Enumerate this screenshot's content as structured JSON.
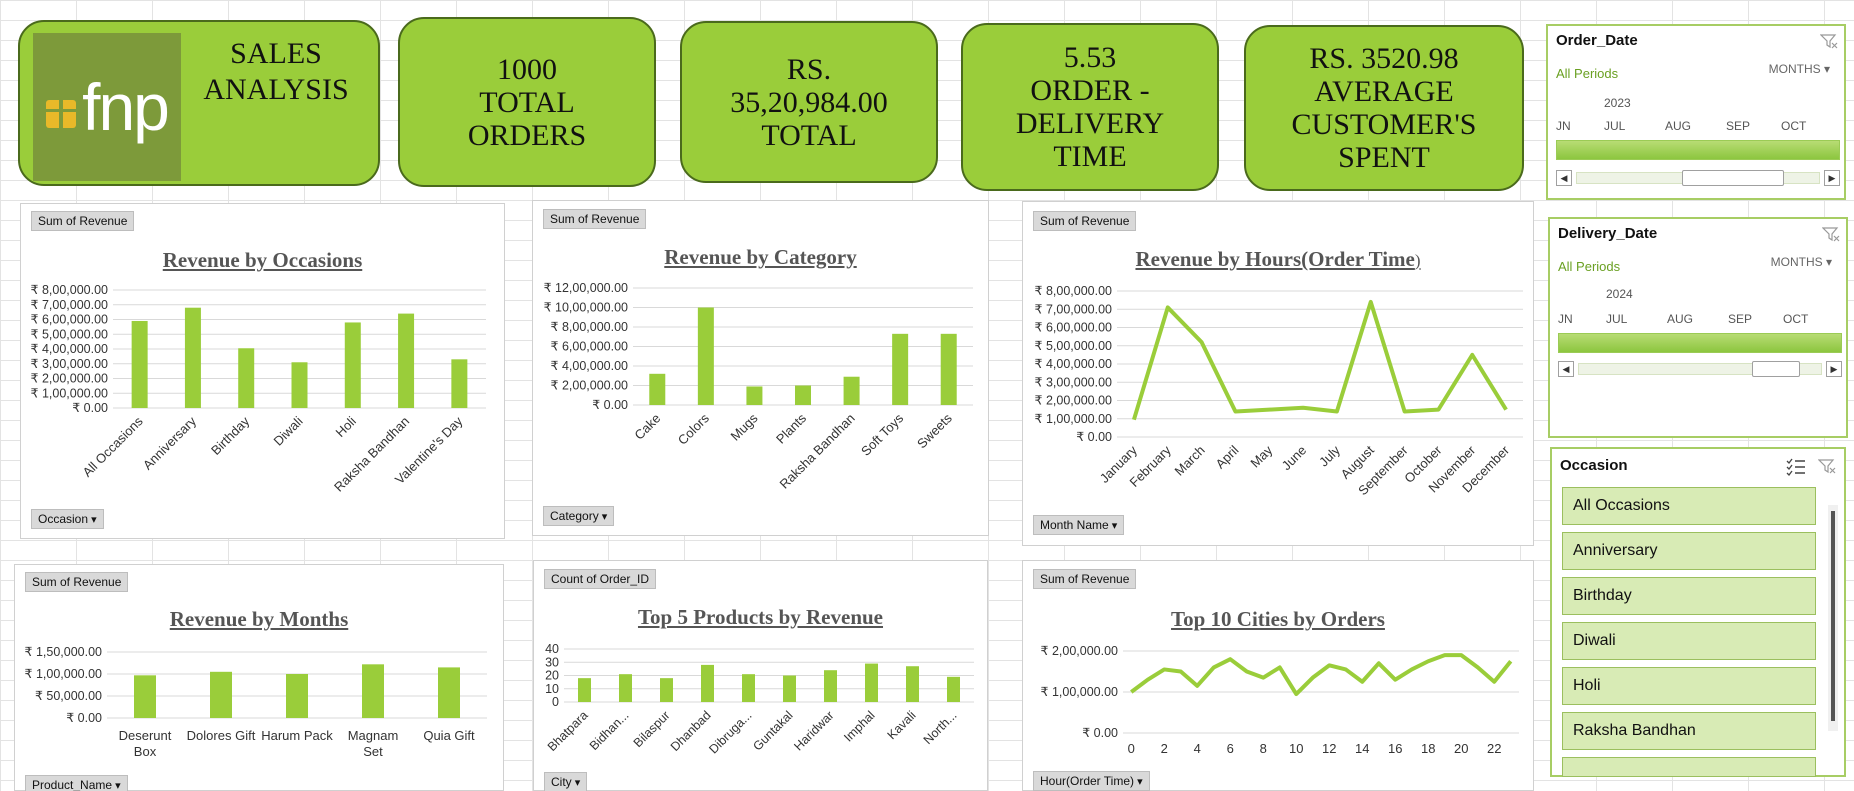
{
  "kpis": {
    "title": "SALES\nANALYSIS",
    "logo_text": "fnp",
    "orders": "1000\nTOTAL\nORDERS",
    "revenue": "RS.\n35,20,984.00\nTOTAL",
    "delivery": "5.53\nORDER -\nDELIVERY\nTIME",
    "avg_spent": "RS. 3520.98\nAVERAGE\nCUSTOMER'S\nSPENT"
  },
  "charts": {
    "occasions": {
      "value_button": "Sum of Revenue",
      "axis_button": "Occasion",
      "title": "Revenue by Occasions",
      "y_ticks": [
        "₹ 8,00,000.00",
        "₹ 7,00,000.00",
        "₹ 6,00,000.00",
        "₹ 5,00,000.00",
        "₹ 4,00,000.00",
        "₹ 3,00,000.00",
        "₹ 2,00,000.00",
        "₹ 1,00,000.00",
        "₹ 0.00"
      ]
    },
    "category": {
      "value_button": "Sum of Revenue",
      "axis_button": "Category",
      "title": "Revenue by Category",
      "y_ticks": [
        "₹ 12,00,000.00",
        "₹ 10,00,000.00",
        "₹ 8,00,000.00",
        "₹ 6,00,000.00",
        "₹ 4,00,000.00",
        "₹ 2,00,000.00",
        "₹ 0.00"
      ]
    },
    "hours": {
      "value_button": "Sum of Revenue",
      "axis_button": "Month Name",
      "title": "Revenue by Hours(Order Time",
      "title_suffix": ")",
      "y_ticks": [
        "₹ 8,00,000.00",
        "₹ 7,00,000.00",
        "₹ 6,00,000.00",
        "₹ 5,00,000.00",
        "₹ 4,00,000.00",
        "₹ 3,00,000.00",
        "₹ 2,00,000.00",
        "₹ 1,00,000.00",
        "₹ 0.00"
      ]
    },
    "months": {
      "value_button": "Sum of Revenue",
      "axis_button": "Product_Name",
      "title": "Revenue by Months",
      "y_ticks": [
        "₹ 1,50,000.00",
        "₹ 1,00,000.00",
        "₹ 50,000.00",
        "₹ 0.00"
      ]
    },
    "products": {
      "value_button": "Count of Order_ID",
      "axis_button": "City",
      "title": "Top 5 Products by Revenue",
      "y_ticks": [
        "40",
        "30",
        "20",
        "10",
        "0"
      ]
    },
    "cities": {
      "value_button": "Sum of Revenue",
      "axis_button": "Hour(Order Time)",
      "title": "Top 10 Cities by Orders",
      "y_ticks": [
        "₹ 2,00,000.00",
        "₹ 1,00,000.00",
        "₹ 0.00"
      ]
    }
  },
  "chart_data": [
    {
      "type": "bar",
      "title": "Revenue by Occasions",
      "categories": [
        "All Occasions",
        "Anniversary",
        "Birthday",
        "Diwali",
        "Holi",
        "Raksha Bandhan",
        "Valentine's Day"
      ],
      "values": [
        590000,
        680000,
        405000,
        310000,
        580000,
        640000,
        330000
      ],
      "ylim": [
        0,
        800000
      ],
      "color": "#9acd3a"
    },
    {
      "type": "bar",
      "title": "Revenue by Category",
      "categories": [
        "Cake",
        "Colors",
        "Mugs",
        "Plants",
        "Raksha Bandhan",
        "Soft Toys",
        "Sweets"
      ],
      "values": [
        320000,
        1000000,
        190000,
        200000,
        290000,
        730000,
        730000
      ],
      "ylim": [
        0,
        1200000
      ],
      "color": "#9acd3a"
    },
    {
      "type": "line",
      "title": "Revenue by Hours(Order Time)",
      "categories": [
        "January",
        "February",
        "March",
        "April",
        "May",
        "June",
        "July",
        "August",
        "September",
        "October",
        "November",
        "December"
      ],
      "values": [
        95000,
        710000,
        520000,
        140000,
        150000,
        160000,
        140000,
        740000,
        140000,
        150000,
        450000,
        150000
      ],
      "ylim": [
        0,
        800000
      ],
      "color": "#9acd3a"
    },
    {
      "type": "bar",
      "title": "Revenue by Months",
      "categories": [
        "Deserunt Box",
        "Dolores Gift",
        "Harum Pack",
        "Magnam Set",
        "Quia Gift"
      ],
      "values": [
        97000,
        105000,
        100000,
        122000,
        115000
      ],
      "ylim": [
        0,
        150000
      ],
      "color": "#9acd3a"
    },
    {
      "type": "bar",
      "title": "Top 5 Products by Revenue",
      "categories": [
        "Bhatpara",
        "Bidhan...",
        "Bilaspur",
        "Dhanbad",
        "Dibruga...",
        "Guntakal",
        "Haridwar",
        "Imphal",
        "Kavali",
        "North..."
      ],
      "values": [
        18,
        21,
        18,
        28,
        21,
        20,
        24,
        29,
        27,
        19
      ],
      "ylim": [
        0,
        40
      ],
      "color": "#9acd3a"
    },
    {
      "type": "line",
      "title": "Top 10 Cities by Orders",
      "x": [
        0,
        1,
        2,
        3,
        4,
        5,
        6,
        7,
        8,
        9,
        10,
        11,
        12,
        13,
        14,
        15,
        16,
        17,
        18,
        19,
        20,
        21,
        22,
        23
      ],
      "x_ticks": [
        "0",
        "2",
        "4",
        "6",
        "8",
        "10",
        "12",
        "14",
        "16",
        "18",
        "20",
        "22"
      ],
      "values": [
        100000,
        130000,
        155000,
        150000,
        115000,
        160000,
        180000,
        150000,
        135000,
        160000,
        95000,
        135000,
        165000,
        155000,
        125000,
        170000,
        130000,
        155000,
        175000,
        190000,
        190000,
        160000,
        125000,
        175000
      ],
      "ylim": [
        0,
        200000
      ],
      "color": "#9acd3a"
    }
  ],
  "slicers": {
    "order_date": {
      "title": "Order_Date",
      "all": "All Periods",
      "period": "MONTHS",
      "year": "2023",
      "months": [
        "JN",
        "JUL",
        "AUG",
        "SEP",
        "OCT"
      ]
    },
    "delivery_date": {
      "title": "Delivery_Date",
      "all": "All Periods",
      "period": "MONTHS",
      "year": "2024",
      "months": [
        "JN",
        "JUL",
        "AUG",
        "SEP",
        "OCT"
      ]
    },
    "occasion": {
      "title": "Occasion",
      "items": [
        "All Occasions",
        "Anniversary",
        "Birthday",
        "Diwali",
        "Holi",
        "Raksha Bandhan"
      ]
    }
  },
  "icons": [
    "filter-clear-icon",
    "multi-select-icon",
    "dropdown-arrow-icon",
    "scroll-left-icon",
    "scroll-right-icon",
    "gift-icon"
  ]
}
